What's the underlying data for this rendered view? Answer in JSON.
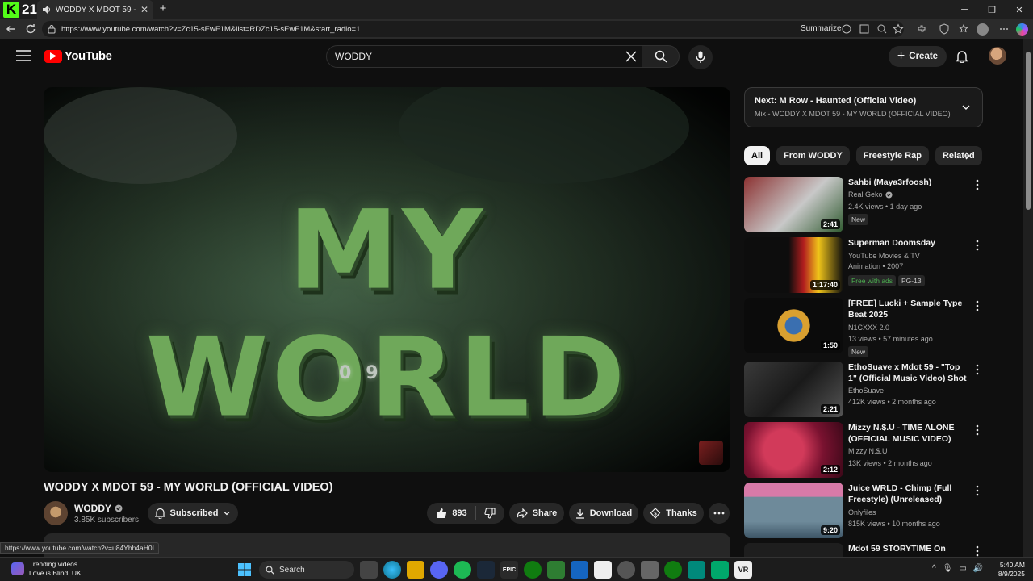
{
  "browser": {
    "tab_badge": "21",
    "tab_title": "WODDY X MDOT 59 - MY W",
    "url": "https://www.youtube.com/watch?v=Zc15-sEwF1M&list=RDZc15-sEwF1M&start_radio=1",
    "summarize_label": "Summarize",
    "status_url": "https://www.youtube.com/watch?v=u84Yhh4aH0I"
  },
  "header": {
    "logo_text": "YouTube",
    "search_value": "WODDY",
    "create_label": "Create"
  },
  "player": {
    "overlay_title": "MY WORLD",
    "overlay_sub": "09"
  },
  "video": {
    "title": "WODDY X MDOT 59 - MY WORLD (OFFICIAL VIDEO)",
    "channel": "WODDY",
    "subscribers": "3.85K subscribers",
    "subscribed_label": "Subscribed",
    "likes": "893",
    "share_label": "Share",
    "download_label": "Download",
    "thanks_label": "Thanks"
  },
  "sidebar": {
    "next_title": "Next: M Row - Haunted (Official Video)",
    "next_sub": "Mix - WODDY X MDOT 59 - MY WORLD (OFFICIAL VIDEO)",
    "chips": [
      "All",
      "From WODDY",
      "Freestyle Rap",
      "Related"
    ],
    "recommendations": [
      {
        "title": "Sahbi (Maya3rfoosh)",
        "channel": "Real Geko",
        "meta": "2.4K views • 1 day ago",
        "badge": "New",
        "duration": "2:41",
        "thumb": "#7a2a2a"
      },
      {
        "title": "Superman Doomsday",
        "channel": "YouTube Movies & TV",
        "meta": "Animation • 2007",
        "badge": "Free with ads",
        "badge2": "PG-13",
        "duration": "1:17:40",
        "thumb": "#1a1a1a"
      },
      {
        "title": "[FREE] Lucki + Sample Type Beat 2025",
        "channel": "N1CXXX 2.0",
        "meta": "13 views • 57 minutes ago",
        "badge": "New",
        "duration": "1:50",
        "thumb": "#0b0b0b"
      },
      {
        "title": "EthoSuave x Mdot 59 - \"Top 1\" (Official Music Video) Shot By ...",
        "channel": "EthoSuave",
        "meta": "412K views • 2 months ago",
        "duration": "2:21",
        "thumb": "#2e2e2e"
      },
      {
        "title": "Mizzy N.$.U - TIME ALONE (OFFICIAL MUSIC VIDEO) SHO...",
        "channel": "Mizzy N.$.U",
        "meta": "13K views • 2 months ago",
        "duration": "2:12",
        "thumb": "#8a1a35"
      },
      {
        "title": "Juice WRLD - Chimp (Full Freestyle) (Unreleased)",
        "channel": "Onlyfiles",
        "meta": "815K views • 10 months ago",
        "duration": "9:20",
        "thumb": "#5d6e7a"
      },
      {
        "title": "Mdot 59 STORYTIME On",
        "thumb": "#222"
      }
    ]
  },
  "taskbar": {
    "trend_title": "Trending videos",
    "trend_sub": "Love is Blind: UK...",
    "search_label": "Search",
    "time": "5:40 AM",
    "date": "8/9/2025"
  }
}
